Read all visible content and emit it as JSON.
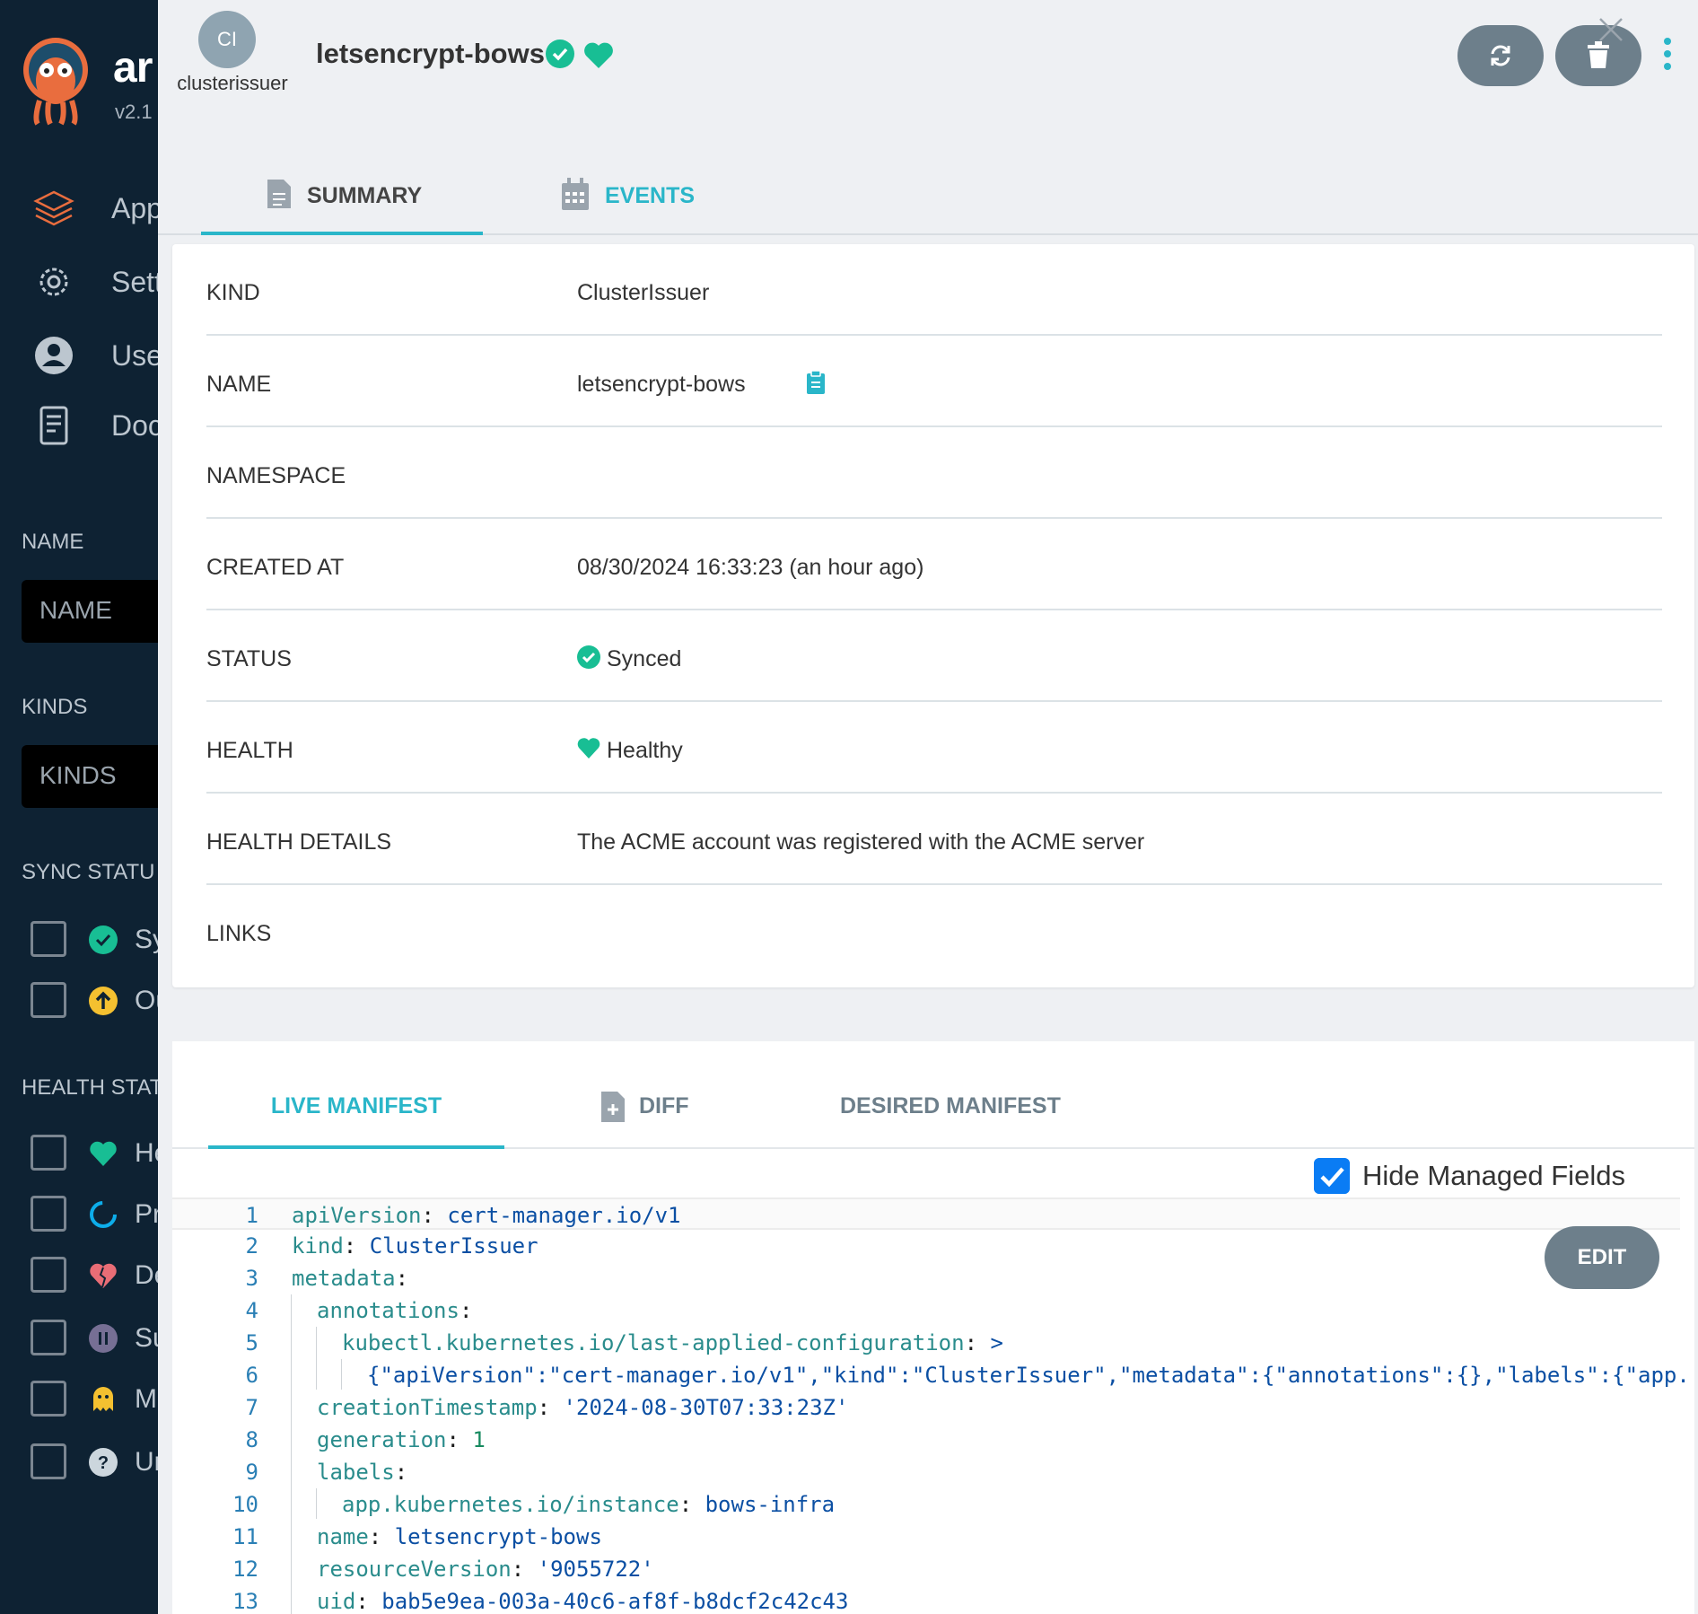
{
  "sidebar": {
    "brand": "ar",
    "version": "v2.1",
    "nav": [
      {
        "label": "App",
        "icon": "layers-icon"
      },
      {
        "label": "Sett",
        "icon": "gear-icon"
      },
      {
        "label": "Use",
        "icon": "user-icon"
      },
      {
        "label": "Doc",
        "icon": "docs-icon"
      }
    ],
    "name_section": "NAME",
    "name_placeholder": "NAME",
    "kinds_section": "KINDS",
    "kinds_placeholder": "KINDS",
    "sync_section": "SYNC STATU",
    "sync_items": [
      {
        "label": "Sy",
        "icon": "synced-icon"
      },
      {
        "label": "Ou",
        "icon": "out-of-sync-icon"
      }
    ],
    "health_section": "HEALTH STAT",
    "health_items": [
      {
        "label": "He",
        "icon": "healthy-icon"
      },
      {
        "label": "Pr",
        "icon": "progressing-icon"
      },
      {
        "label": "De",
        "icon": "degraded-icon"
      },
      {
        "label": "Su",
        "icon": "suspended-icon"
      },
      {
        "label": "Mi",
        "icon": "missing-icon"
      },
      {
        "label": "Un",
        "icon": "unknown-icon"
      }
    ]
  },
  "header": {
    "avatar": "CI",
    "kind": "clusterissuer",
    "title": "letsencrypt-bows"
  },
  "tabs": {
    "summary": "SUMMARY",
    "events": "EVENTS"
  },
  "summary": {
    "rows": [
      {
        "key": "KIND",
        "value": "ClusterIssuer"
      },
      {
        "key": "NAME",
        "value": "letsencrypt-bows"
      },
      {
        "key": "NAMESPACE",
        "value": ""
      },
      {
        "key": "CREATED AT",
        "value": "08/30/2024 16:33:23  (an hour ago)"
      },
      {
        "key": "STATUS",
        "value": "Synced"
      },
      {
        "key": "HEALTH",
        "value": "Healthy"
      },
      {
        "key": "HEALTH DETAILS",
        "value": "The ACME account was registered with the ACME server"
      },
      {
        "key": "LINKS",
        "value": ""
      }
    ]
  },
  "manifest": {
    "tabs": {
      "live": "LIVE MANIFEST",
      "diff": "DIFF",
      "desired": "DESIRED MANIFEST"
    },
    "hide_managed": "Hide Managed Fields",
    "edit": "EDIT",
    "lines": [
      "apiVersion: cert-manager.io/v1",
      "kind: ClusterIssuer",
      "metadata:",
      "annotations:",
      "kubectl.kubernetes.io/last-applied-configuration: >",
      "{\"apiVersion\":\"cert-manager.io/v1\",\"kind\":\"ClusterIssuer\",\"metadata\":{\"annotations\":{},\"labels\":{\"app.",
      "creationTimestamp: '2024-08-30T07:33:23Z'",
      "generation: 1",
      "labels:",
      "app.kubernetes.io/instance: bows-infra",
      "name: letsencrypt-bows",
      "resourceVersion: '9055722'",
      "uid: bab5e9ea-003a-40c6-af8f-b8dcf2c42c43"
    ]
  },
  "colors": {
    "accent": "#2ab6c9",
    "synced": "#18be94",
    "healthy": "#18be94",
    "sidebar": "#0e2233"
  }
}
